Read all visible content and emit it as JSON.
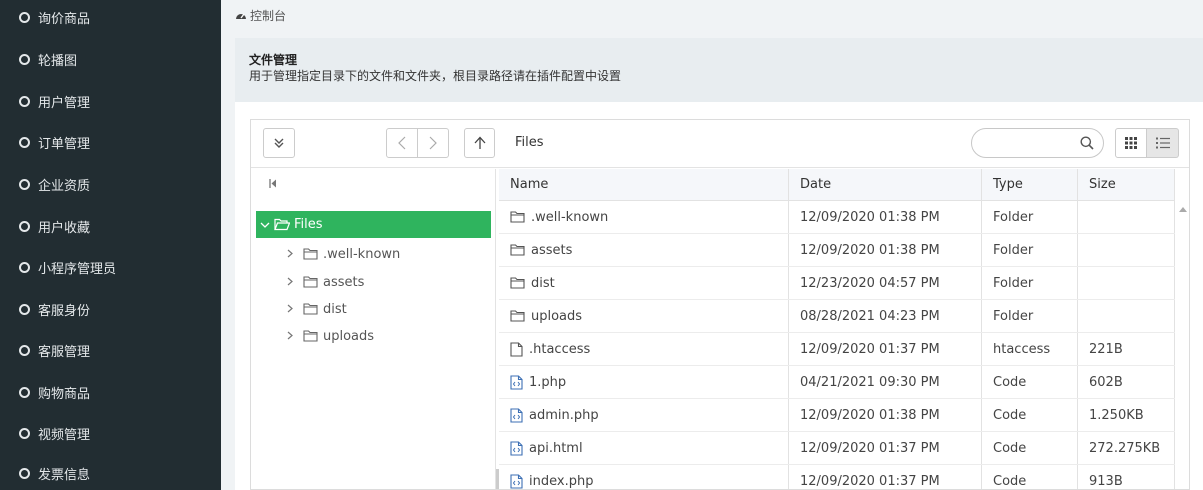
{
  "sidebar": {
    "items": [
      {
        "label": "询价商品"
      },
      {
        "label": "轮播图"
      },
      {
        "label": "用户管理"
      },
      {
        "label": "订单管理"
      },
      {
        "label": "企业资质"
      },
      {
        "label": "用户收藏"
      },
      {
        "label": "小程序管理员"
      },
      {
        "label": "客服身份"
      },
      {
        "label": "客服管理"
      },
      {
        "label": "购物商品"
      },
      {
        "label": "视频管理"
      },
      {
        "label": "发票信息"
      }
    ]
  },
  "breadcrumb": {
    "label": "控制台",
    "icon": "dashboard-icon"
  },
  "panel": {
    "title": "文件管理",
    "description": "用于管理指定目录下的文件和文件夹，根目录路径请在插件配置中设置"
  },
  "toolbar": {
    "path": "Files",
    "search_placeholder": "",
    "search_value": ""
  },
  "tree": {
    "root": "Files",
    "children": [
      {
        "label": ".well-known"
      },
      {
        "label": "assets"
      },
      {
        "label": "dist"
      },
      {
        "label": "uploads"
      }
    ]
  },
  "table": {
    "columns": {
      "name": "Name",
      "date": "Date",
      "type": "Type",
      "size": "Size"
    },
    "rows": [
      {
        "name": ".well-known",
        "date": "12/09/2020 01:38 PM",
        "type": "Folder",
        "size": "",
        "icon": "folder-icon"
      },
      {
        "name": "assets",
        "date": "12/09/2020 01:38 PM",
        "type": "Folder",
        "size": "",
        "icon": "folder-icon"
      },
      {
        "name": "dist",
        "date": "12/23/2020 04:57 PM",
        "type": "Folder",
        "size": "",
        "icon": "folder-icon"
      },
      {
        "name": "uploads",
        "date": "08/28/2021 04:23 PM",
        "type": "Folder",
        "size": "",
        "icon": "folder-icon"
      },
      {
        "name": ".htaccess",
        "date": "12/09/2020 01:37 PM",
        "type": "htaccess",
        "size": "221B",
        "icon": "file-icon"
      },
      {
        "name": "1.php",
        "date": "04/21/2021 09:30 PM",
        "type": "Code",
        "size": "602B",
        "icon": "code-file-icon"
      },
      {
        "name": "admin.php",
        "date": "12/09/2020 01:38 PM",
        "type": "Code",
        "size": "1.250KB",
        "icon": "code-file-icon"
      },
      {
        "name": "api.html",
        "date": "12/09/2020 01:37 PM",
        "type": "Code",
        "size": "272.275KB",
        "icon": "code-file-icon"
      },
      {
        "name": "index.php",
        "date": "12/09/2020 01:37 PM",
        "type": "Code",
        "size": "913B",
        "icon": "code-file-icon"
      }
    ]
  },
  "colors": {
    "sidebar_bg": "#222d32",
    "accent_green": "#2fb45e",
    "icon_blue": "#3c6fb4"
  }
}
